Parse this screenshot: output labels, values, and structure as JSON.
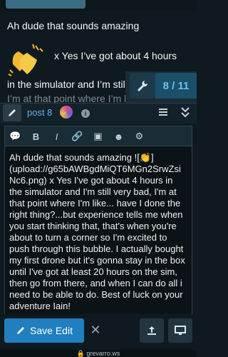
{
  "header": {
    "logo_text": "",
    "logo_sub": ""
  },
  "post": {
    "line1": "Ah dude that sounds amazing",
    "line2": "x Yes I’ve got about 4 hours",
    "line3": "in the simulator and I’m still",
    "line4": "I’m at that point where I’m li"
  },
  "progress": {
    "current": 8,
    "total": 11,
    "label": "8 / 11"
  },
  "composer": {
    "post_ref": "post 8",
    "info": "i",
    "toolbar": [
      {
        "name": "quote-icon",
        "glyph": "💬"
      },
      {
        "name": "bold-icon",
        "glyph": "B"
      },
      {
        "name": "italic-icon",
        "glyph": "I"
      },
      {
        "name": "link-icon",
        "glyph": "🔗"
      },
      {
        "name": "image-icon",
        "glyph": "▣"
      },
      {
        "name": "emoji-icon",
        "glyph": "☻"
      },
      {
        "name": "settings-icon",
        "glyph": "⚙"
      }
    ],
    "body": "Ah dude that sounds amazing ![👏](upload://g65bAWBgdMiQT6MGn2SrwZsiNc6.png) x Yes I've got about 4 hours in the simulator and I'm still very bad, I'm at that point where I'm like... have I done the right thing?...but experience tells me when you start thinking that, that's when you're about to turn a corner so I'm excited to push through this bubble. I actually bought my first drone but it's gonna stay in the box until I've got at least 20 hours on the sim, then go from there, and when I can do all i need to be able to do. Best of luck on your adventure Iain!"
  },
  "actions": {
    "save_label": "Save Edit",
    "cancel_glyph": "✕"
  },
  "browser": {
    "url": "🔒 grevarro.ws"
  }
}
